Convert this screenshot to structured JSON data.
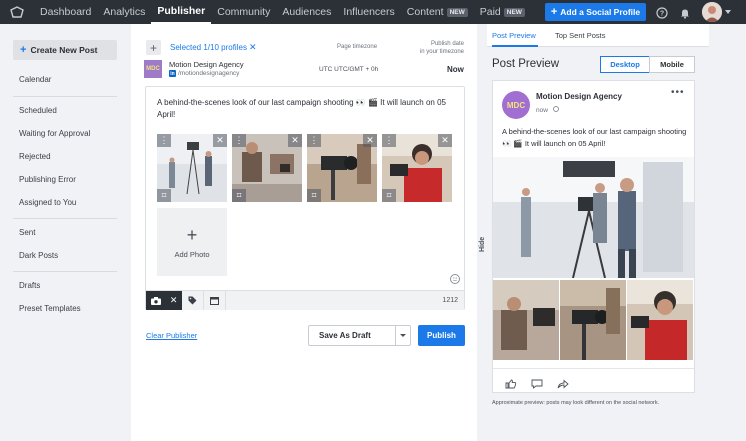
{
  "topnav": {
    "items": [
      {
        "label": "Dashboard",
        "active": false
      },
      {
        "label": "Analytics",
        "active": false
      },
      {
        "label": "Publisher",
        "active": true
      },
      {
        "label": "Community",
        "active": false
      },
      {
        "label": "Audiences",
        "active": false
      },
      {
        "label": "Influencers",
        "active": false
      },
      {
        "label": "Content",
        "active": false,
        "badge": "NEW"
      },
      {
        "label": "Paid",
        "active": false,
        "badge": "NEW"
      }
    ],
    "add_profile_label": "Add a Social Profile",
    "icons": [
      "logo-icon",
      "help-icon",
      "bell-icon",
      "avatar",
      "chevron-down-icon"
    ]
  },
  "sidebar": {
    "create_label": "Create New Post",
    "items": [
      "Calendar",
      "Scheduled",
      "Waiting for Approval",
      "Rejected",
      "Publishing Error",
      "Assigned to You",
      "Sent",
      "Dark Posts",
      "Drafts",
      "Preset Templates"
    ]
  },
  "composer": {
    "selected_profiles": "Selected 1/10 profiles",
    "page_timezone_label": "Page timezone",
    "publish_date_label_1": "Publish date",
    "publish_date_label_2": "in your timezone",
    "profile": {
      "initials": "MDC",
      "name": "Motion Design Agency",
      "handle": "/motiondesignagency",
      "timezone": "UTC UTC/GMT + 0h",
      "publish_time": "Now"
    },
    "post_text": "A behind-the-scenes look of our last campaign shooting 👀 🎬 It will launch on 05 April!",
    "add_photo_label": "Add Photo",
    "char_count": "1212",
    "clear_label": "Clear Publisher",
    "draft_label": "Save As Draft",
    "publish_label": "Publish"
  },
  "hide_label": "Hide",
  "preview": {
    "tabs": [
      {
        "label": "Post Preview",
        "active": true
      },
      {
        "label": "Top Sent Posts",
        "active": false
      }
    ],
    "title": "Post Preview",
    "desktop_label": "Desktop",
    "mobile_label": "Mobile",
    "card": {
      "initials": "MDC",
      "name": "Motion Design Agency",
      "time": "now",
      "text": "A behind-the-scenes look of our last campaign shooting 👀 🎬 It will launch on 05 April!"
    },
    "disclaimer": "Approximate preview: posts may look different on the social network."
  },
  "colors": {
    "accent": "#1b7ae8",
    "nav_bg": "#2c3037",
    "brand_purple": "#a06fd1"
  }
}
